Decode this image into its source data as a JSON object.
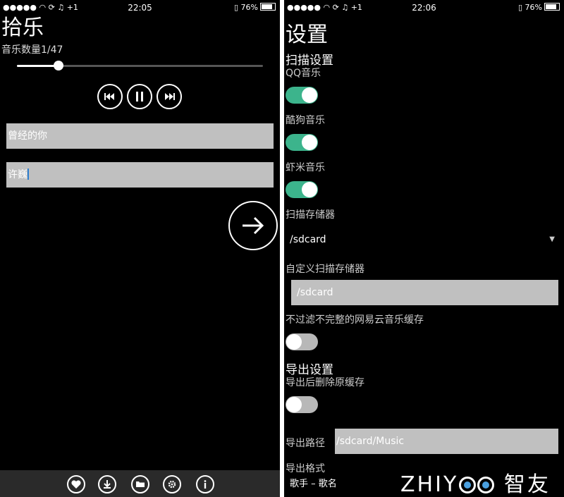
{
  "status_bar": {
    "left_screen": {
      "carrier": "●●●●● ",
      "signal_extra": "+1",
      "time": "22:05",
      "battery": "76%"
    },
    "right_screen": {
      "carrier": "●●●●● ",
      "signal_extra": "+1",
      "time": "22:06",
      "battery": "76%"
    }
  },
  "player": {
    "app_title": "拾乐",
    "track_count": "音乐数量1/47",
    "progress_fraction": 0.17,
    "song_title_value": "曾经的你",
    "artist_value": "许巍",
    "bottom_icons": [
      "heart-icon",
      "download-icon",
      "folder-icon",
      "gear-icon",
      "info-icon"
    ]
  },
  "settings": {
    "title": "设置",
    "scan_section": "扫描设置",
    "qq_music_label": "QQ音乐",
    "qq_music_on": true,
    "kugou_label": "酷狗音乐",
    "kugou_on": true,
    "xiami_label": "虾米音乐",
    "xiami_on": true,
    "scan_storage_label": "扫描存储器",
    "scan_storage_value": "/sdcard",
    "custom_storage_label": "自定义扫描存储器",
    "custom_storage_value": "/sdcard",
    "netease_label": "不过滤不完整的网易云音乐缓存",
    "netease_on": false,
    "export_section": "导出设置",
    "delete_after_export_label": "导出后删除原缓存",
    "delete_after_export_on": false,
    "export_path_label": "导出路径",
    "export_path_value": "/sdcard/Music",
    "export_format_label": "导出格式",
    "export_format_value": "歌手 – 歌名"
  },
  "watermark": {
    "latin": "ZHIY",
    "latin_end": "",
    "cjk": "智友"
  },
  "colors": {
    "accent_toggle": "#3cb48c",
    "field_bg": "#c0c0c0",
    "bottom_bar": "#2a2a2a"
  }
}
